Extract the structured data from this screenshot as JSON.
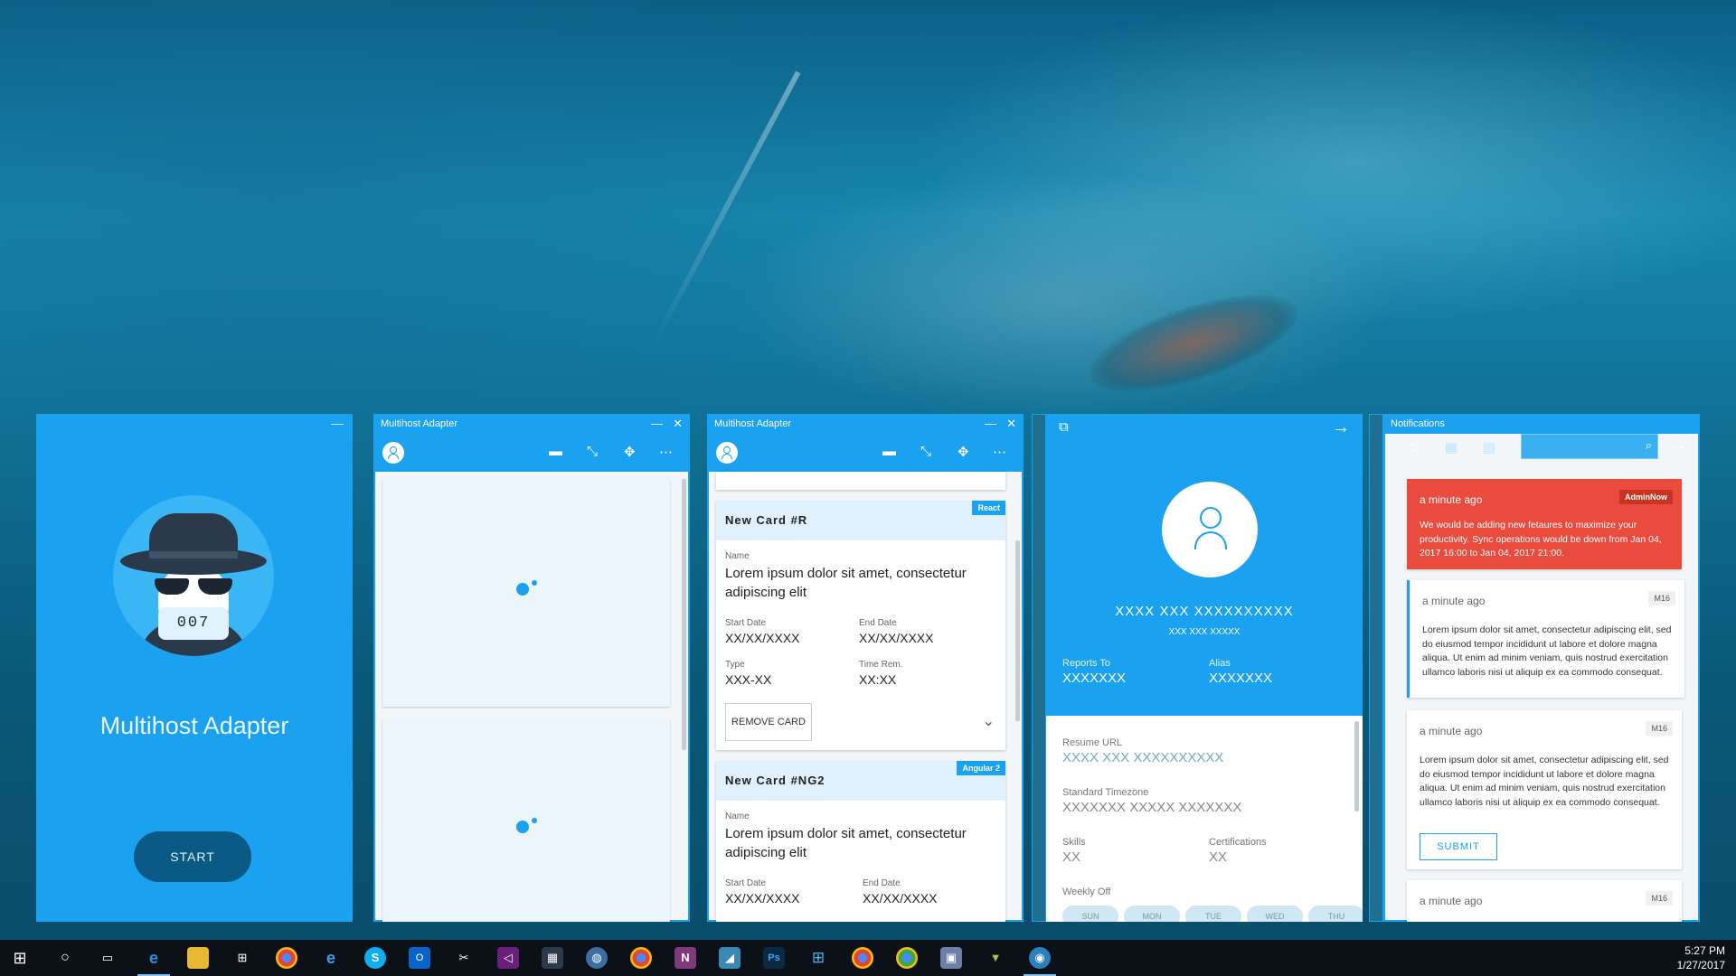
{
  "windows": {
    "splash": {
      "badge_number": "007",
      "app_title": "Multihost Adapter",
      "start_label": "START",
      "minimize_glyph": "—"
    },
    "loading": {
      "title": "Multihost Adapter"
    },
    "cards": {
      "title": "Multihost Adapter",
      "card1": {
        "title": "New Card #R",
        "badge": "React",
        "name_label": "Name",
        "name_value": "Lorem ipsum dolor sit amet, consectetur adipiscing elit",
        "start_label": "Start Date",
        "start_value": "XX/XX/XXXX",
        "end_label": "End Date",
        "end_value": "XX/XX/XXXX",
        "type_label": "Type",
        "type_value": "XXX-XX",
        "time_label": "Time Rem.",
        "time_value": "XX:XX",
        "remove_label": "REMOVE CARD"
      },
      "card2": {
        "title": "New Card #NG2",
        "badge": "Angular 2",
        "name_label": "Name",
        "name_value": "Lorem ipsum dolor sit amet, consectetur adipiscing elit",
        "start_label": "Start Date",
        "start_value": "XX/XX/XXXX",
        "end_label": "End Date",
        "end_value": "XX/XX/XXXX"
      }
    },
    "profile": {
      "name": "XXXX XXX XXXXXXXXXX",
      "subtitle": "XXX XXX XXXXX",
      "reports_label": "Reports To",
      "reports_value": "XXXXXXX",
      "alias_label": "Alias",
      "alias_value": "XXXXXXX",
      "resume_label": "Resume URL",
      "resume_value": "XXXX XXX XXXXXXXXXX",
      "timezone_label": "Standard Timezone",
      "timezone_value": "XXXXXXX XXXXX XXXXXXX",
      "skills_label": "Skills",
      "skills_value": "XX",
      "cert_label": "Certifications",
      "cert_value": "XX",
      "weekly_label": "Weekly Off",
      "days": [
        "SUN",
        "MON",
        "TUE",
        "WED",
        "THU"
      ]
    },
    "notifications": {
      "title": "Notifications",
      "items": [
        {
          "time": "a minute ago",
          "badge": "AdminNow",
          "message": "We would be adding new fetaures to maximize your productivity. Sync operations would be down from Jan 04, 2017 16:00 to Jan 04, 2017 21:00."
        },
        {
          "time": "a minute ago",
          "badge": "M16",
          "message": "Lorem ipsum dolor sit amet, consectetur adipiscing elit, sed do eiusmod tempor incididunt ut labore et dolore magna aliqua. Ut enim ad minim veniam, quis nostrud exercitation ullamco laboris nisi ut aliquip ex ea commodo consequat."
        },
        {
          "time": "a minute ago",
          "badge": "M16",
          "message": "Lorem ipsum dolor sit amet, consectetur adipiscing elit, sed do eiusmod tempor incididunt ut labore et dolore magna aliqua. Ut enim ad minim veniam, quis nostrud exercitation ullamco laboris nisi ut aliquip ex ea commodo consequat."
        },
        {
          "time": "a minute ago",
          "badge": "M16"
        }
      ],
      "submit_label": "SUBMIT"
    }
  },
  "taskbar": {
    "time": "5:27 PM",
    "date": "1/27/2017",
    "icons": [
      "windows-start-icon",
      "cortana-icon",
      "task-view-icon",
      "edge-icon",
      "file-explorer-icon",
      "store-icon",
      "chrome-icon",
      "ie-icon",
      "skype-icon",
      "outlook-icon",
      "snipping-icon",
      "visual-studio-icon",
      "teams-icon",
      "globe-icon",
      "chrome-icon",
      "onenote-icon",
      "paint-icon",
      "photoshop-icon",
      "windows-icon",
      "chrome-icon",
      "chrome-icon",
      "remote-desktop-icon",
      "android-icon",
      "app-icon"
    ]
  },
  "colors": {
    "accent": "#1aa1ef",
    "danger": "#e94b3c",
    "dark_button": "#0b5a86"
  }
}
